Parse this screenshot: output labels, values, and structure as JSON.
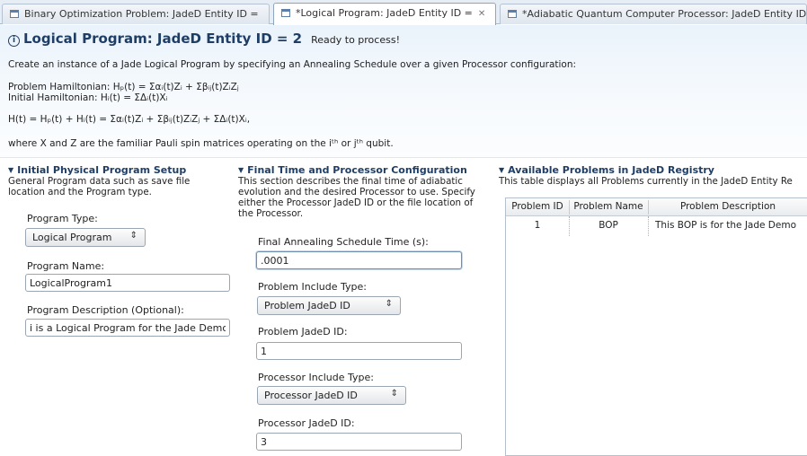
{
  "tabs": [
    {
      "label": "Binary Optimization Problem: JadeD Entity ID ="
    },
    {
      "label": "*Logical Program: JadeD Entity ID =",
      "close": "✕"
    },
    {
      "label": "*Adiabatic Quantum Computer Processor: JadeD Entity ID"
    }
  ],
  "header": {
    "title": "Logical Program: JadeD Entity ID = 2",
    "status": "Ready to process!",
    "intro": "Create an instance of a Jade Logical Program by specifying an Annealing Schedule over a given Processor configuration:",
    "problem_hamiltonian": "Problem Hamiltonian: Hₚ(t) = Σαᵢ(t)Zᵢ + Σβᵢⱼ(t)ZᵢZⱼ",
    "initial_hamiltonian": "Initial Hamiltonian: Hᵢ(t) = ΣΔᵢ(t)Xᵢ",
    "total_hamiltonian": "H(t) = Hₚ(t) + Hᵢ(t) = Σαᵢ(t)Zᵢ + Σβᵢⱼ(t)ZᵢZⱼ + ΣΔᵢ(t)Xᵢ,",
    "pauli_note": "where X and Z are the familiar Pauli spin matrices operating on the iᵗʰ or jᵗʰ qubit."
  },
  "initial_setup": {
    "heading": "Initial Physical Program Setup",
    "description": "General Program data such as save file location and the Program type.",
    "program_type_label": "Program Type:",
    "program_type_value": "Logical Program",
    "program_name_label": "Program Name:",
    "program_name_value": "LogicalProgram1",
    "program_description_label": "Program Description (Optional):",
    "program_description_value": "i is a Logical Program for the Jade Demo"
  },
  "final_time": {
    "heading": "Final Time and Processor Configuration",
    "description": "This section describes the final time of adiabatic evolution and the desired Processor to use. Specify either the Processor JadeD ID or the file location of the Processor.",
    "annealing_time_label": "Final Annealing Schedule Time (s):",
    "annealing_time_value": ".0001",
    "problem_include_label": "Problem Include Type:",
    "problem_include_value": "Problem JadeD ID",
    "problem_id_label": "Problem JadeD ID:",
    "problem_id_value": "1",
    "processor_include_label": "Processor Include Type:",
    "processor_include_value": "Processor JadeD ID",
    "processor_id_label": "Processor JadeD ID:",
    "processor_id_value": "3"
  },
  "registry": {
    "heading": "Available Problems in JadeD Registry",
    "description": "This table displays all Problems currently in the JadeD Entity Re",
    "columns": [
      "Problem ID",
      "Problem Name",
      "Problem Description"
    ],
    "rows": [
      {
        "id": "1",
        "name": "BOP",
        "description": "This BOP is for the Jade Demo"
      }
    ]
  },
  "icons": {
    "info": "info-icon",
    "collapse": "triangle-down-icon",
    "combo": "up-down-arrows-icon",
    "tab": "editor-tab-icon"
  },
  "colors": {
    "title": "#1f3e66",
    "header_bg": "#eaf3fb"
  }
}
